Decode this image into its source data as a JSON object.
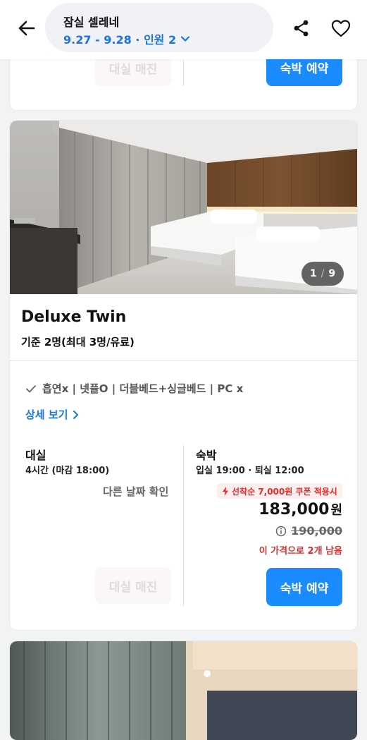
{
  "header": {
    "title": "잠실 셀레네",
    "dates_guests": "9.27 - 9.28 · 인원 2"
  },
  "top_card": {
    "dayuse_button": "대실 매진",
    "stay_button": "숙박 예약"
  },
  "room": {
    "photo_counter_current": "1",
    "photo_counter_total": "9",
    "name": "Deluxe Twin",
    "capacity": "기준 2명(최대 3명/유료)",
    "amenities": "흡연x | 넷플O  |  더블베드+싱글베드 | PC x",
    "detail_link": "상세 보기",
    "dayuse": {
      "title": "대실",
      "hours": "4시간 (마감 18:00)",
      "other_date": "다른 날짜 확인",
      "button": "대실 매진"
    },
    "stay": {
      "title": "숙박",
      "checkin_out": "입실 19:00 · 퇴실 12:00",
      "coupon": "선착순 7,000원 쿠폰 적용시",
      "price": "183,000",
      "currency": "원",
      "original_price": "190,000",
      "remaining": "이 가격으로 2개 남음",
      "button": "숙박 예약"
    }
  },
  "colors": {
    "accent": "#1a8cff",
    "link": "#1a73e8",
    "alert": "#e02d2d"
  },
  "icons": [
    "back-arrow-icon",
    "chevron-down-icon",
    "share-icon",
    "heart-icon",
    "check-icon",
    "chevron-right-icon",
    "bolt-icon",
    "info-icon"
  ]
}
